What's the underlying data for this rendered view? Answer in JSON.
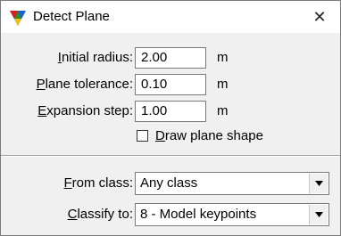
{
  "window": {
    "title": "Detect Plane",
    "close_glyph": "✕"
  },
  "fields": [
    {
      "access_key": "I",
      "label_rest": "nitial radius:",
      "value": "2.00",
      "unit": "m"
    },
    {
      "access_key": "P",
      "label_rest": "lane tolerance:",
      "value": "0.10",
      "unit": "m"
    },
    {
      "access_key": "E",
      "label_rest": "xpansion step:",
      "value": "1.00",
      "unit": "m"
    }
  ],
  "draw_plane_shape": {
    "access_key": "D",
    "label_rest": "raw plane shape",
    "checked": false
  },
  "from_class": {
    "access_key": "F",
    "label_rest": "rom class:",
    "value": "Any class"
  },
  "classify_to": {
    "access_key": "C",
    "label_rest": "lassify to:",
    "value": "8 - Model keypoints"
  },
  "icons": {
    "app": "terrasolid-triangle-icon",
    "dropdown": "chevron-down-icon"
  },
  "colors": {
    "background": "#f0f0f0",
    "titlebar": "#ffffff"
  }
}
